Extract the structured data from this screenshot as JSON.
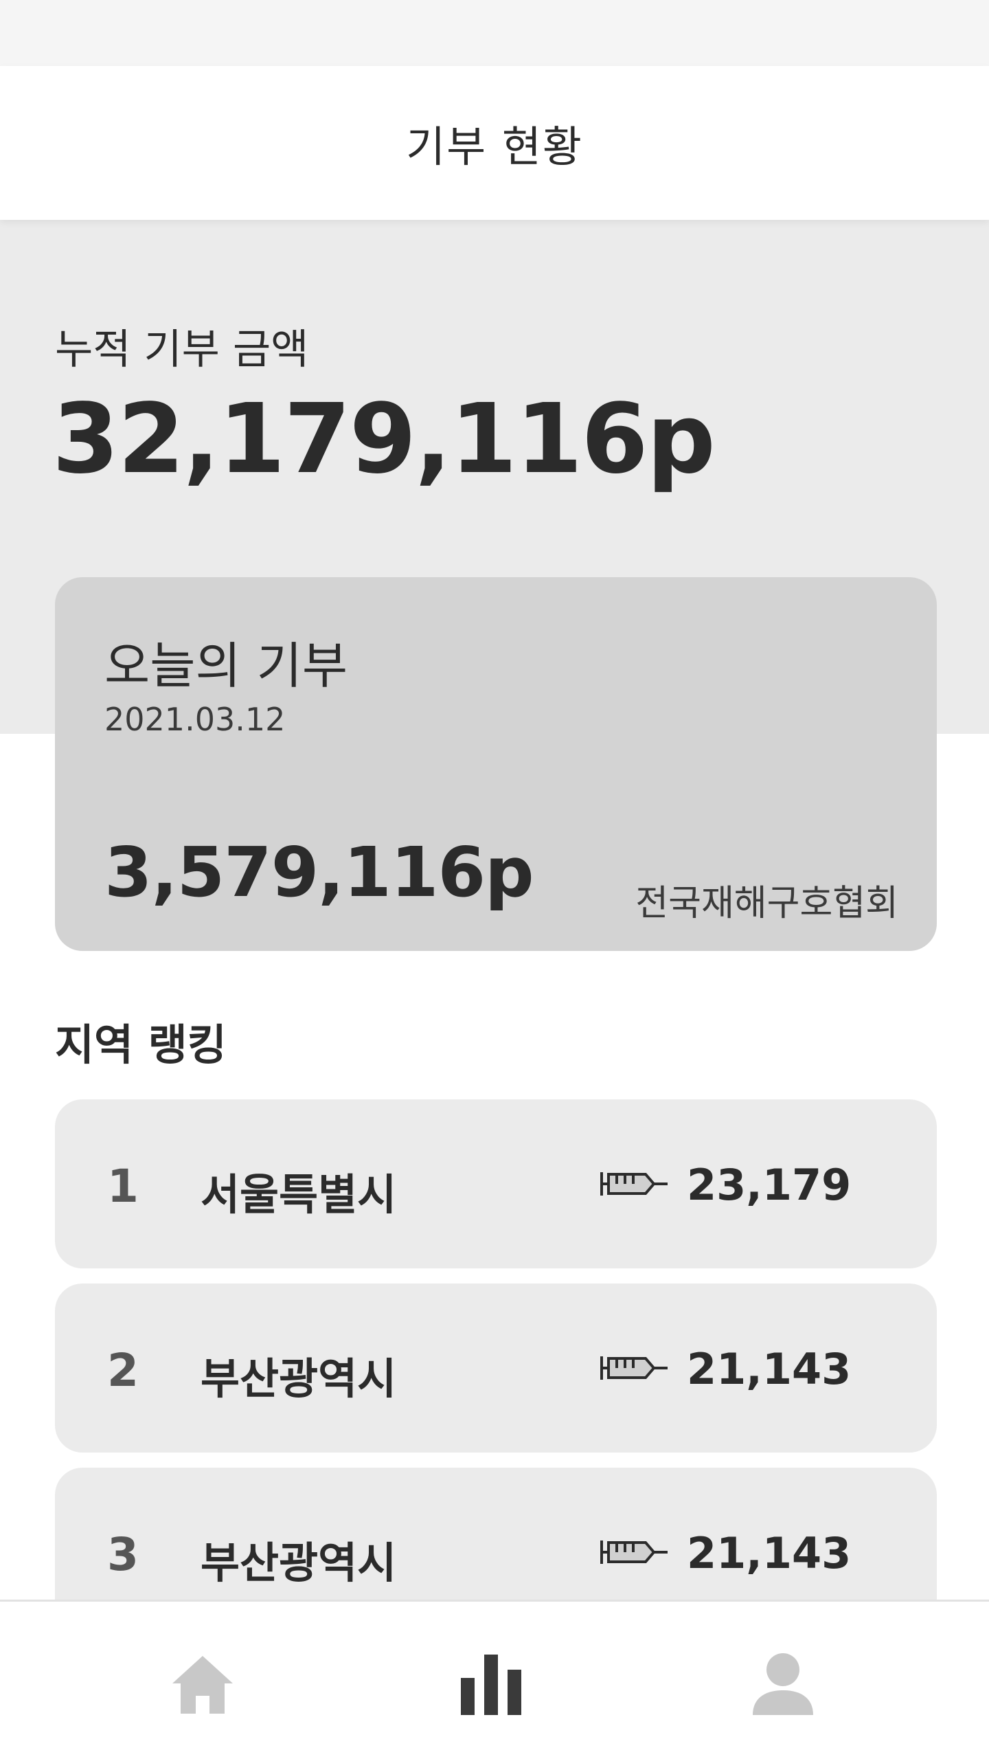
{
  "header": {
    "title": "기부 현황"
  },
  "summary": {
    "total_label": "누적 기부 금액",
    "total_amount": "32,179,116p"
  },
  "today": {
    "title": "오늘의 기부",
    "date": "2021.03.12",
    "amount": "3,579,116p",
    "organization": "전국재해구호협회"
  },
  "ranking": {
    "title": "지역 랭킹",
    "items": [
      {
        "rank": "1",
        "region": "서울특별시",
        "icon": "syringe-icon",
        "value": "23,179"
      },
      {
        "rank": "2",
        "region": "부산광역시",
        "icon": "syringe-icon",
        "value": "21,143"
      },
      {
        "rank": "3",
        "region": "부산광역시",
        "icon": "syringe-icon",
        "value": "21,143"
      }
    ]
  },
  "nav": {
    "items": [
      {
        "icon": "home-icon",
        "active": false
      },
      {
        "icon": "bar-chart-icon",
        "active": true
      },
      {
        "icon": "person-icon",
        "active": false
      }
    ],
    "active_color": "#3a3a3a",
    "inactive_color": "#c8c8c8"
  },
  "colors": {
    "summary_bg": "#ebebeb",
    "card_bg": "#d3d3d3",
    "text": "#2b2b2b"
  }
}
